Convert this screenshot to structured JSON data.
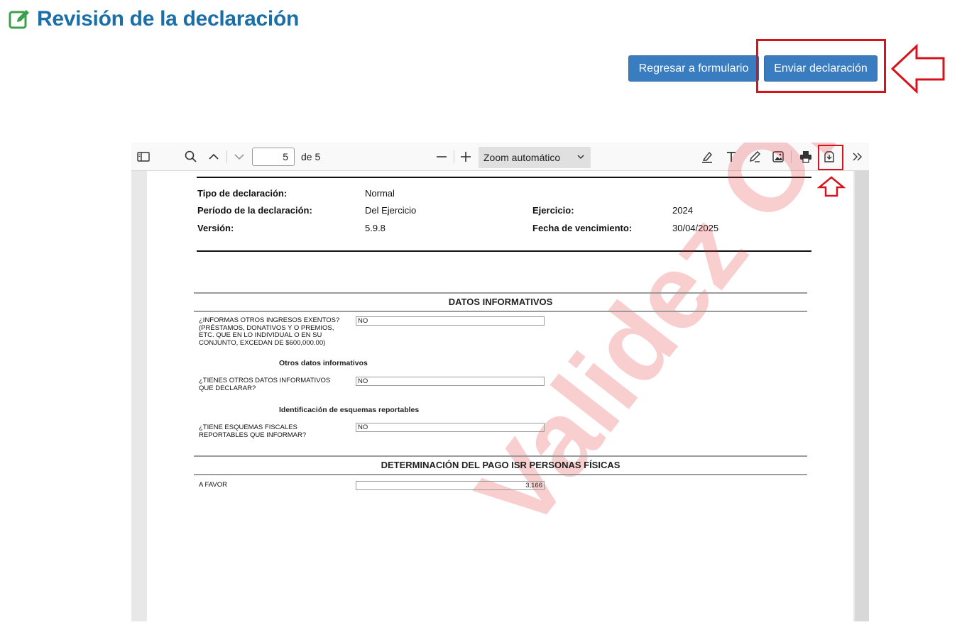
{
  "header": {
    "title": "Revisión de la declaración",
    "icon": "edit-icon"
  },
  "actions": {
    "back_label": "Regresar a formulario",
    "send_label": "Enviar declaración"
  },
  "viewer": {
    "page_current": "5",
    "page_total_label": "de 5",
    "zoom_label": "Zoom automático"
  },
  "document": {
    "labels": {
      "tipo": "Tipo de declaración:",
      "periodo": "Período de la declaración:",
      "version": "Versión:",
      "ejercicio": "Ejercicio:",
      "fecha": "Fecha de vencimiento:"
    },
    "values": {
      "tipo": "Normal",
      "periodo": "Del Ejercicio",
      "version": "5.9.8",
      "ejercicio": "2024",
      "fecha": "30/04/2025"
    },
    "section1": "DATOS INFORMATIVOS",
    "q1": "¿INFORMAS OTROS INGRESOS EXENTOS? (PRÉSTAMOS, DONATIVOS Y O PREMIOS, ETC. QUE EN LO INDIVIDUAL O EN SU CONJUNTO, EXCEDAN DE $600,000.00)",
    "a1": "NO",
    "sub1": "Otros datos informativos",
    "q2": "¿TIENES OTROS DATOS INFORMATIVOS QUE DECLARAR?",
    "a2": "NO",
    "sub2": "Identificación de esquemas reportables",
    "q3": "¿TIENE ESQUEMAS FISCALES REPORTABLES QUE INFORMAR?",
    "a3": "NO",
    "section2": "DETERMINACIÓN DEL PAGO ISR PERSONAS FÍSICAS",
    "q4": "A FAVOR",
    "a4": "3,166",
    "watermark": "Validez Oficial"
  },
  "colors": {
    "accent": "#1a6fa8",
    "button": "#3a7cc0",
    "highlight": "#d7121b"
  }
}
